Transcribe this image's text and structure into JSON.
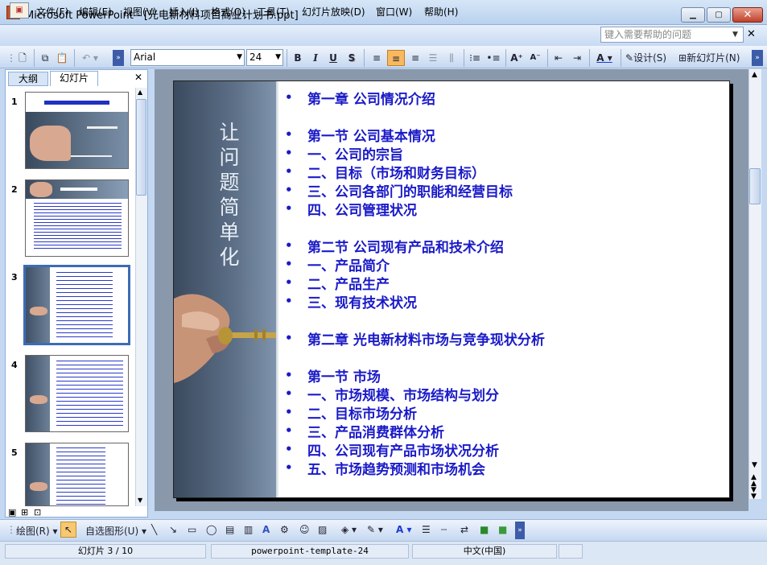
{
  "window": {
    "title": "Microsoft PowerPoint - [光电新材料项目商业计划书.ppt]"
  },
  "menu": [
    "文件(F)",
    "编辑(E)",
    "视图(V)",
    "插入(I)",
    "格式(O)",
    "工具(T)",
    "幻灯片放映(D)",
    "窗口(W)",
    "帮助(H)"
  ],
  "help": {
    "placeholder": "键入需要帮助的问题"
  },
  "toolbar": {
    "font": "Arial",
    "size": "24",
    "bold": "B",
    "italic": "I",
    "underline": "U",
    "shadow": "S",
    "design": "设计(S)",
    "new_slide": "新幻灯片(N)"
  },
  "panel": {
    "tabs": [
      "大纲",
      "幻灯片"
    ],
    "numbers": [
      "1",
      "2",
      "3",
      "4",
      "5"
    ]
  },
  "slide": {
    "side_title": [
      "让",
      "问",
      "题",
      "简",
      "单",
      "化"
    ],
    "bullets": [
      "第一章 公司情况介绍",
      "第一节 公司基本情况",
      "一、公司的宗旨",
      "二、目标（市场和财务目标）",
      "三、公司各部门的职能和经营目标",
      "四、公司管理状况",
      "第二节 公司现有产品和技术介绍",
      "一、产品简介",
      "二、产品生产",
      "三、现有技术状况",
      "第二章 光电新材料市场与竞争现状分析",
      "第一节 市场",
      "一、市场规模、市场结构与划分",
      "二、目标市场分析",
      "三、产品消费群体分析",
      "四、公司现有产品市场状况分析",
      "五、市场趋势预测和市场机会"
    ]
  },
  "drawing": {
    "draw": "绘图(R)",
    "autoshapes": "自选图形(U)"
  },
  "status": {
    "slide": "幻灯片 3 / 10",
    "template": "powerpoint-template-24",
    "language": "中文(中国)"
  }
}
